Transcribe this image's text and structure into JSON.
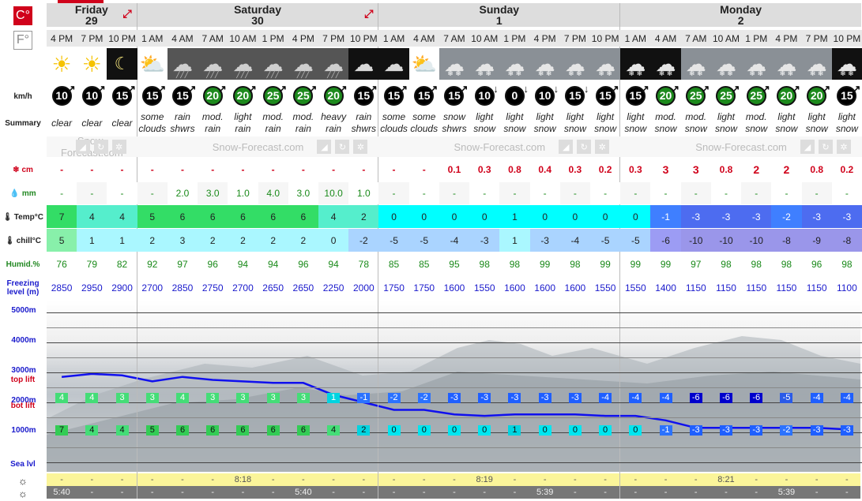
{
  "units": {
    "celsius_label": "C°",
    "fahrenheit_label": "F°"
  },
  "days": [
    {
      "name": "Friday",
      "date": "29"
    },
    {
      "name": "Saturday",
      "date": "30"
    },
    {
      "name": "Sunday",
      "date": "1"
    },
    {
      "name": "Monday",
      "date": "2"
    }
  ],
  "times": [
    "4 PM",
    "7 PM",
    "10 PM",
    "1 AM",
    "4 AM",
    "7 AM",
    "10 AM",
    "1 PM",
    "4 PM",
    "7 PM",
    "10 PM",
    "1 AM",
    "4 AM",
    "7 AM",
    "10 AM",
    "1 PM",
    "4 PM",
    "7 PM",
    "10 PM",
    "1 AM",
    "4 AM",
    "7 AM",
    "10 AM",
    "1 PM",
    "4 PM",
    "7 PM",
    "10 PM"
  ],
  "weather_icons": [
    "sun-icon",
    "sun-icon",
    "moon-icon",
    "sun-cloud-icon",
    "cloud-rain-icon",
    "cloud-rain-icon",
    "cloud-rain-icon",
    "cloud-rain-icon",
    "cloud-rain-icon",
    "cloud-rain-icon",
    "moon-cloud-icon",
    "moon-cloud-icon",
    "sun-cloud-icon",
    "sun-cloud-snow-icon",
    "cloud-snow-icon",
    "cloud-snow-icon",
    "cloud-snow-icon",
    "cloud-snow-icon",
    "cloud-snow-icon",
    "cloud-snow-icon",
    "cloud-snow-icon",
    "cloud-snow-icon",
    "cloud-snow-icon",
    "cloud-snow-icon",
    "cloud-snow-icon",
    "cloud-snow-icon",
    "cloud-snow-icon"
  ],
  "labels": {
    "wind": "km/h",
    "summary": "Summary",
    "snow": "cm",
    "rain": "mm",
    "temp": "Temp°C",
    "chill": "chill°C",
    "humid": "Humid.%",
    "freezing": "Freezing level (m)",
    "top_lift": "top lift",
    "bot_lift": "bot lift",
    "sea_level": "Sea lvl"
  },
  "wind_speeds": [
    "10",
    "10",
    "15",
    "15",
    "15",
    "20",
    "20",
    "25",
    "25",
    "20",
    "15",
    "15",
    "15",
    "15",
    "10",
    "0",
    "10",
    "15",
    "15",
    "15",
    "20",
    "25",
    "25",
    "25",
    "20",
    "20",
    "15"
  ],
  "summary": [
    "clear",
    "clear",
    "clear",
    "some clouds",
    "rain shwrs",
    "mod. rain",
    "light rain",
    "mod. rain",
    "mod. rain",
    "heavy rain",
    "rain shwrs",
    "some clouds",
    "some clouds",
    "snow shwrs",
    "light snow",
    "light snow",
    "light snow",
    "light snow",
    "light snow",
    "light snow",
    "mod. snow",
    "mod. snow",
    "light snow",
    "mod. snow",
    "light snow",
    "light snow",
    "light snow"
  ],
  "watermark": "Snow-Forecast.com",
  "snow_cm": [
    "-",
    "-",
    "-",
    "-",
    "-",
    "-",
    "-",
    "-",
    "-",
    "-",
    "-",
    "-",
    "-",
    "0.1",
    "0.3",
    "0.8",
    "0.4",
    "0.3",
    "0.2",
    "0.3",
    "3",
    "3",
    "0.8",
    "2",
    "2",
    "0.8",
    "0.2"
  ],
  "rain_mm": [
    "-",
    "-",
    "-",
    "-",
    "2.0",
    "3.0",
    "1.0",
    "4.0",
    "3.0",
    "10.0",
    "1.0",
    "-",
    "-",
    "-",
    "-",
    "-",
    "-",
    "-",
    "-",
    "-",
    "-",
    "-",
    "-",
    "-",
    "-",
    "-",
    "-"
  ],
  "temp": [
    "7",
    "4",
    "4",
    "5",
    "6",
    "6",
    "6",
    "6",
    "6",
    "4",
    "2",
    "0",
    "0",
    "0",
    "0",
    "1",
    "0",
    "0",
    "0",
    "0",
    "-1",
    "-3",
    "-3",
    "-3",
    "-2",
    "-3",
    "-3"
  ],
  "chill": [
    "5",
    "1",
    "1",
    "2",
    "3",
    "2",
    "2",
    "2",
    "2",
    "0",
    "-2",
    "-5",
    "-5",
    "-4",
    "-3",
    "1",
    "-3",
    "-4",
    "-5",
    "-5",
    "-6",
    "-10",
    "-10",
    "-10",
    "-8",
    "-9",
    "-8"
  ],
  "humidity": [
    "76",
    "79",
    "82",
    "92",
    "97",
    "96",
    "94",
    "94",
    "96",
    "94",
    "78",
    "85",
    "85",
    "95",
    "98",
    "98",
    "99",
    "98",
    "99",
    "99",
    "99",
    "97",
    "98",
    "98",
    "98",
    "96",
    "98"
  ],
  "freezing_level": [
    "2850",
    "2950",
    "2900",
    "2700",
    "2850",
    "2750",
    "2700",
    "2650",
    "2650",
    "2250",
    "2000",
    "1750",
    "1750",
    "1600",
    "1550",
    "1600",
    "1600",
    "1600",
    "1550",
    "1550",
    "1400",
    "1150",
    "1150",
    "1150",
    "1150",
    "1150",
    "1100"
  ],
  "altitude_labels": [
    "5000m",
    "4000m",
    "3000m",
    "2000m",
    "1000m"
  ],
  "top_lift_temps": [
    "4",
    "4",
    "3",
    "3",
    "4",
    "3",
    "3",
    "3",
    "3",
    "1",
    "-1",
    "-2",
    "-2",
    "-3",
    "-3",
    "-3",
    "-3",
    "-3",
    "-4",
    "-4",
    "-4",
    "-6",
    "-6",
    "-6",
    "-5",
    "-4",
    "-4"
  ],
  "bot_lift_temps": [
    "7",
    "4",
    "4",
    "5",
    "6",
    "6",
    "6",
    "6",
    "6",
    "4",
    "2",
    "0",
    "0",
    "0",
    "0",
    "1",
    "0",
    "0",
    "0",
    "0",
    "-1",
    "-3",
    "-3",
    "-3",
    "-2",
    "-3",
    "-3"
  ],
  "sunset_row": [
    "-",
    "-",
    "-",
    "-",
    "-",
    "-",
    "8:18",
    "-",
    "-",
    "-",
    "-",
    "-",
    "-",
    "-",
    "8:19",
    "-",
    "-",
    "-",
    "-",
    "-",
    "-",
    "-",
    "8:21",
    "-",
    "-",
    "-",
    "-"
  ],
  "sunrise_row": [
    "5:40",
    "-",
    "-",
    "-",
    "-",
    "-",
    "-",
    "-",
    "5:40",
    "-",
    "-",
    "-",
    "-",
    "-",
    "-",
    "-",
    "5:39",
    "-",
    "-",
    "-",
    "-",
    "-",
    "-",
    "-",
    "5:39",
    "-",
    "-"
  ],
  "colors": {
    "accent_red": "#d0021b",
    "header_grey": "#dddddd",
    "warm_green": "#33cc55",
    "cyan": "#00ffff",
    "blue_dark": "#0000cc"
  }
}
